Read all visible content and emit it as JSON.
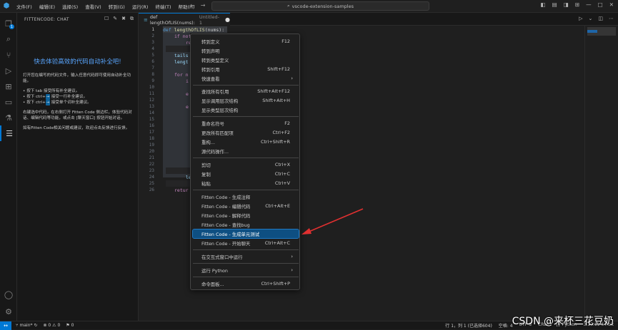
{
  "titlebar": {
    "menus": [
      "文件(F)",
      "编辑(E)",
      "选择(S)",
      "查看(V)",
      "转到(G)",
      "运行(R)",
      "终端(T)",
      "帮助(H)"
    ],
    "search": "vscode-extension-samples",
    "logo": "vscode-logo-icon"
  },
  "activity": {
    "explorer_badge": "1"
  },
  "sidebar": {
    "header": "FITTENCODE: CHAT",
    "title": "快去体验高效的代码自动补全吧!",
    "intro": "打开您在编写的代码文件，输入任意代码即可使用自动补全功能。",
    "bullet1": "• 按下 tab 接受所有补全建议。",
    "bullet2_pre": "• 按下 ctrl+",
    "bullet2_key": "→",
    "bullet2_post": " 接受一行补全建议。",
    "bullet3_pre": "• 按下 ctrl+",
    "bullet3_key": "→",
    "bullet3_post": " 接受单个词补全建议。",
    "chat_hint": "右键选中代码，在右侧打开 Fitten Code 侧边栏，体验代码对话、编辑代码等功能，或点击 [聊天窗口] 按钮开始对话。",
    "feedback": "如有Fitten Code相关问题或建议，欢迎点击反馈进行反馈。"
  },
  "editor": {
    "tab_title": "def lengthOfLIS(nums):",
    "tab_muted": "Untitled-1",
    "line_numbers": [
      "1",
      "2",
      "3",
      "4",
      "5",
      "6",
      "7",
      "8",
      "9",
      "10",
      "11",
      "12",
      "13",
      "14",
      "15",
      "16",
      "17",
      "18",
      "19",
      "20",
      "21",
      "22",
      "23",
      "24",
      "25",
      "26"
    ],
    "line1_kw": "def",
    "line1_fn": "lengthOfLIS",
    "line1_rest": "(nums):",
    "line2": "if not",
    "line3": "re",
    "line5": "tails",
    "line6": "lengt",
    "line8": "for n",
    "line9": "i",
    "line11": "e",
    "line13": "e",
    "line24": "le",
    "line25": "retur"
  },
  "context_menu": {
    "items": [
      {
        "label": "转到定义",
        "shortcut": "F12"
      },
      {
        "label": "转到声明",
        "shortcut": ""
      },
      {
        "label": "转到类型定义",
        "shortcut": ""
      },
      {
        "label": "转到引用",
        "shortcut": "Shift+F12"
      },
      {
        "label": "快速查看",
        "shortcut": ""
      },
      {
        "label": "查找所有引用",
        "shortcut": "Shift+Alt+F12"
      },
      {
        "label": "显示调用层次结构",
        "shortcut": "Shift+Alt+H"
      },
      {
        "label": "显示类型层次结构",
        "shortcut": ""
      },
      {
        "label": "重命名符号",
        "shortcut": "F2"
      },
      {
        "label": "更改所有匹配项",
        "shortcut": "Ctrl+F2"
      },
      {
        "label": "重构...",
        "shortcut": "Ctrl+Shift+R"
      },
      {
        "label": "源代码操作...",
        "shortcut": ""
      },
      {
        "label": "剪切",
        "shortcut": "Ctrl+X"
      },
      {
        "label": "复制",
        "shortcut": "Ctrl+C"
      },
      {
        "label": "粘贴",
        "shortcut": "Ctrl+V"
      },
      {
        "label": "Fitten Code - 生成注释",
        "shortcut": ""
      },
      {
        "label": "Fitten Code - 编辑代码",
        "shortcut": "Ctrl+Alt+E"
      },
      {
        "label": "Fitten Code - 解释代码",
        "shortcut": ""
      },
      {
        "label": "Fitten Code - 查找bug",
        "shortcut": ""
      },
      {
        "label": "Fitten Code - 生成单元测试",
        "shortcut": ""
      },
      {
        "label": "Fitten Code - 开始聊天",
        "shortcut": "Ctrl+Alt+C"
      },
      {
        "label": "在交互式窗口中运行",
        "shortcut": ""
      },
      {
        "label": "运行 Python",
        "shortcut": ""
      },
      {
        "label": "命令面板...",
        "shortcut": "Ctrl+Shift+P"
      }
    ]
  },
  "statusbar": {
    "branch": "main*",
    "errors": "0",
    "warnings": "0",
    "ports": "0",
    "position": "行 1，列 1 (已选择604)",
    "spaces": "空格: 4",
    "encoding": "UTF-8",
    "eol": "CRLF",
    "language": "Python",
    "version": "3.10.11 64-bit"
  },
  "watermark": "CSDN @来杯三花豆奶",
  "colors": {
    "accent": "#0078d4",
    "menu_selected": "#0e4f82",
    "arrow": "#e03030",
    "title_blue": "#59a6ff"
  }
}
